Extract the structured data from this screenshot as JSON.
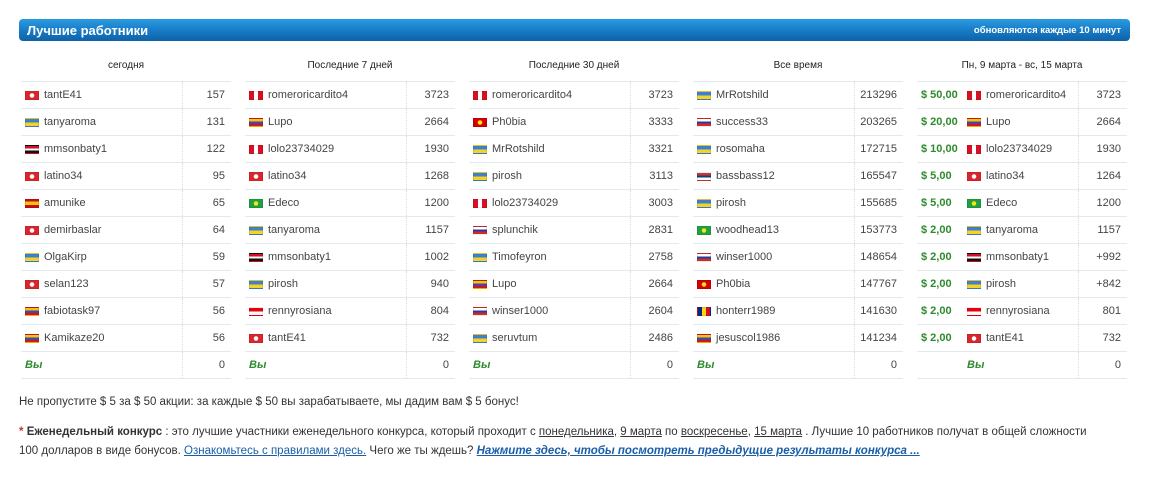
{
  "header": {
    "title": "Лучшие работники",
    "note": "обновляются каждые 10 минут"
  },
  "flags": {
    "tr": {
      "type": "solid",
      "c": [
        "#d9262c"
      ],
      "mark": "#ffffff"
    },
    "ua": {
      "type": "h",
      "c": [
        "#3d7fd6",
        "#f5d320"
      ]
    },
    "eg": {
      "type": "h",
      "c": [
        "#ce1126",
        "#ffffff",
        "#111111"
      ]
    },
    "es": {
      "type": "h3",
      "c": [
        "#c60b1e",
        "#f6c400",
        "#c60b1e"
      ]
    },
    "ve": {
      "type": "h",
      "c": [
        "#f6c400",
        "#2a52be",
        "#cf142b"
      ]
    },
    "pe": {
      "type": "v",
      "c": [
        "#d91023",
        "#ffffff",
        "#d91023"
      ]
    },
    "br": {
      "type": "solid",
      "c": [
        "#229e45"
      ],
      "mark": "#f8e509"
    },
    "mk": {
      "type": "solid",
      "c": [
        "#d20000"
      ],
      "mark": "#ffe600"
    },
    "ru": {
      "type": "h",
      "c": [
        "#ffffff",
        "#1c3fa8",
        "#d52b1e"
      ]
    },
    "id": {
      "type": "h",
      "c": [
        "#e70011",
        "#ffffff"
      ]
    },
    "rs": {
      "type": "h",
      "c": [
        "#c6363c",
        "#0c4076",
        "#ffffff"
      ]
    },
    "ro": {
      "type": "v",
      "c": [
        "#002b7f",
        "#fcd116",
        "#ce1126"
      ]
    },
    "ar": {
      "type": "h",
      "c": [
        "#74acdf",
        "#ffffff",
        "#74acdf"
      ]
    }
  },
  "columns": [
    {
      "title": "сегодня",
      "rows": [
        {
          "flag": "tr",
          "name": "tantE41",
          "value": "157"
        },
        {
          "flag": "ua",
          "name": "tanyaroma",
          "value": "131"
        },
        {
          "flag": "eg",
          "name": "mmsonbaty1",
          "value": "122"
        },
        {
          "flag": "tr",
          "name": "latino34",
          "value": "95"
        },
        {
          "flag": "es",
          "name": "amunike",
          "value": "65"
        },
        {
          "flag": "tr",
          "name": "demirbaslar",
          "value": "64"
        },
        {
          "flag": "ua",
          "name": "OlgaKirp",
          "value": "59"
        },
        {
          "flag": "tr",
          "name": "selan123",
          "value": "57"
        },
        {
          "flag": "ve",
          "name": "fabiotask97",
          "value": "56"
        },
        {
          "flag": "ve",
          "name": "Kamikaze20",
          "value": "56"
        }
      ],
      "you": {
        "name": "Вы",
        "value": "0"
      }
    },
    {
      "title": "Последние 7 дней",
      "rows": [
        {
          "flag": "pe",
          "name": "romeroricardito4",
          "value": "3723"
        },
        {
          "flag": "ve",
          "name": "Lupo",
          "value": "2664"
        },
        {
          "flag": "pe",
          "name": "lolo23734029",
          "value": "1930"
        },
        {
          "flag": "tr",
          "name": "latino34",
          "value": "1268"
        },
        {
          "flag": "br",
          "name": "Edeco",
          "value": "1200"
        },
        {
          "flag": "ua",
          "name": "tanyaroma",
          "value": "1157"
        },
        {
          "flag": "eg",
          "name": "mmsonbaty1",
          "value": "1002"
        },
        {
          "flag": "ua",
          "name": "pirosh",
          "value": "940"
        },
        {
          "flag": "id",
          "name": "rennyrosiana",
          "value": "804"
        },
        {
          "flag": "tr",
          "name": "tantE41",
          "value": "732"
        }
      ],
      "you": {
        "name": "Вы",
        "value": "0"
      }
    },
    {
      "title": "Последние 30 дней",
      "rows": [
        {
          "flag": "pe",
          "name": "romeroricardito4",
          "value": "3723"
        },
        {
          "flag": "mk",
          "name": "Ph0bia",
          "value": "3333"
        },
        {
          "flag": "ua",
          "name": "MrRotshild",
          "value": "3321"
        },
        {
          "flag": "ua",
          "name": "pirosh",
          "value": "3113"
        },
        {
          "flag": "pe",
          "name": "lolo23734029",
          "value": "3003"
        },
        {
          "flag": "ru",
          "name": "splunchik",
          "value": "2831"
        },
        {
          "flag": "ua",
          "name": "Timofeyron",
          "value": "2758"
        },
        {
          "flag": "ve",
          "name": "Lupo",
          "value": "2664"
        },
        {
          "flag": "ru",
          "name": "winser1000",
          "value": "2604"
        },
        {
          "flag": "ua",
          "name": "seruvtum",
          "value": "2486"
        }
      ],
      "you": {
        "name": "Вы",
        "value": "0"
      }
    },
    {
      "title": "Все время",
      "rows": [
        {
          "flag": "ua",
          "name": "MrRotshild",
          "value": "213296"
        },
        {
          "flag": "ru",
          "name": "success33",
          "value": "203265"
        },
        {
          "flag": "ua",
          "name": "rosomaha",
          "value": "172715"
        },
        {
          "flag": "rs",
          "name": "bassbass12",
          "value": "165547"
        },
        {
          "flag": "ua",
          "name": "pirosh",
          "value": "155685"
        },
        {
          "flag": "br",
          "name": "woodhead13",
          "value": "153773"
        },
        {
          "flag": "ru",
          "name": "winser1000",
          "value": "148654"
        },
        {
          "flag": "mk",
          "name": "Ph0bia",
          "value": "147767"
        },
        {
          "flag": "ro",
          "name": "honterr1989",
          "value": "141630"
        },
        {
          "flag": "ve",
          "name": "jesuscol1986",
          "value": "141234"
        }
      ],
      "you": {
        "name": "Вы",
        "value": "0"
      }
    },
    {
      "title": "Пн, 9 марта - вс, 15 марта",
      "rows": [
        {
          "prize": "$ 50,00",
          "flag": "pe",
          "name": "romeroricardito4",
          "value": "3723"
        },
        {
          "prize": "$ 20,00",
          "flag": "ve",
          "name": "Lupo",
          "value": "2664"
        },
        {
          "prize": "$ 10,00",
          "flag": "pe",
          "name": "lolo23734029",
          "value": "1930"
        },
        {
          "prize": "$ 5,00",
          "flag": "tr",
          "name": "latino34",
          "value": "1264"
        },
        {
          "prize": "$ 5,00",
          "flag": "br",
          "name": "Edeco",
          "value": "1200"
        },
        {
          "prize": "$ 2,00",
          "flag": "ua",
          "name": "tanyaroma",
          "value": "1157"
        },
        {
          "prize": "$ 2,00",
          "flag": "eg",
          "name": "mmsonbaty1",
          "value": "+992"
        },
        {
          "prize": "$ 2,00",
          "flag": "ua",
          "name": "pirosh",
          "value": "+842"
        },
        {
          "prize": "$ 2,00",
          "flag": "id",
          "name": "rennyrosiana",
          "value": "801"
        },
        {
          "prize": "$ 2,00",
          "flag": "tr",
          "name": "tantE41",
          "value": "732"
        }
      ],
      "you": {
        "name": "Вы",
        "value": "0"
      }
    }
  ],
  "promo": "Не пропустите $ 5 за $ 50 акции: за каждые $ 50 вы зарабатываете, мы дадим вам $ 5 бонус!",
  "weekly": {
    "star": "*",
    "label": "Еженедельный конкурс",
    "t1": " : это лучшие участники еженедельного конкурса, который проходит с ",
    "d1": "понедельника",
    "comma": ", ",
    "d2": "9 марта",
    "t2": " по ",
    "d3": "воскресенье",
    "d4": "15 марта",
    "t3": " . Лучшие 10 работников получат в общей сложности 100 долларов в виде бонусов. ",
    "rules_link": "Ознакомьтесь с правилами здесь.",
    "t4": " Чего же ты ждешь? ",
    "results_link": "Нажмите здесь, чтобы посмотреть предыдущие результаты конкурса ..."
  }
}
